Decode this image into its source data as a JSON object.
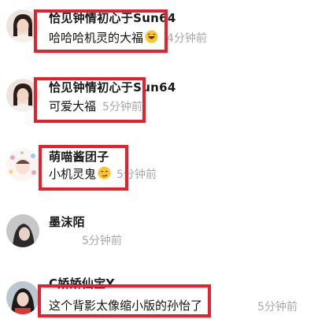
{
  "comments": [
    {
      "name": "恰见钟情初心于Sun64",
      "text": "哈哈哈机灵的大福",
      "emoji": "laughing-emoji",
      "time": "4分钟前"
    },
    {
      "name": "恰见钟情初心于Sun64",
      "text": "可爱大福",
      "time": "5分钟前"
    },
    {
      "name": "萌喵酱团子",
      "text": "小机灵鬼",
      "emoji": "smirk-emoji",
      "time": "5分钟前"
    },
    {
      "name": "墨沫陌",
      "time": "5分钟前"
    },
    {
      "name": "C娇娇仙宝Y",
      "text": "这个背影太像缩小版的孙怡了",
      "time": "5分钟前"
    }
  ],
  "colors": {
    "highlight": "#e5212b",
    "time": "#a8a8a8"
  }
}
